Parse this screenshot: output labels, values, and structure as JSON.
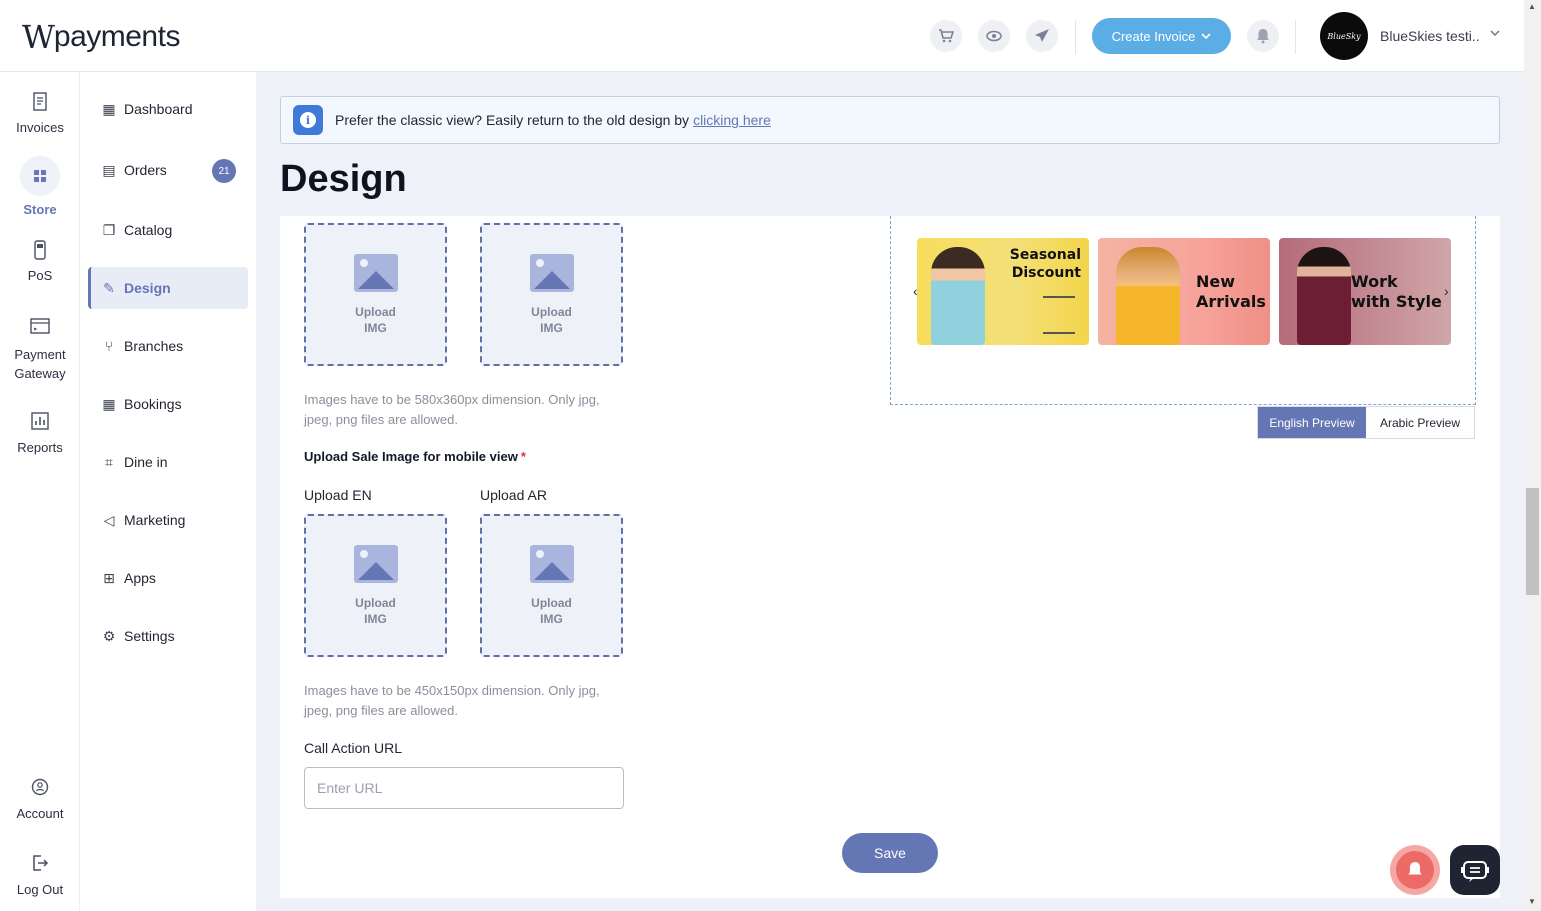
{
  "header": {
    "logo_mark": "W",
    "logo_text": "payments",
    "icons": [
      "cart-icon",
      "eye-icon",
      "send-icon",
      "bell-icon"
    ],
    "create_invoice_label": "Create Invoice",
    "profile_avatar_text": "BlueSky",
    "profile_name": "BlueSkies testi...",
    "accent_color": "#5aaee5"
  },
  "rail": {
    "items": [
      {
        "label": "Invoices",
        "icon": "invoice-icon"
      },
      {
        "label": "Store",
        "icon": "store-icon",
        "active": true
      },
      {
        "label": "PoS",
        "icon": "pos-icon"
      },
      {
        "label": "Payment Gateway",
        "icon": "payment-gateway-icon"
      },
      {
        "label": "Reports",
        "icon": "reports-icon"
      },
      {
        "label": "Account",
        "icon": "account-icon"
      },
      {
        "label": "Log Out",
        "icon": "logout-icon"
      }
    ]
  },
  "sidebar": {
    "items": [
      {
        "label": "Dashboard",
        "icon": "dashboard-icon"
      },
      {
        "label": "Orders",
        "icon": "orders-icon",
        "badge": "21"
      },
      {
        "label": "Catalog",
        "icon": "catalog-icon"
      },
      {
        "label": "Design",
        "icon": "design-icon",
        "active": true
      },
      {
        "label": "Branches",
        "icon": "branches-icon"
      },
      {
        "label": "Bookings",
        "icon": "bookings-icon"
      },
      {
        "label": "Dine in",
        "icon": "dine-in-icon"
      },
      {
        "label": "Marketing",
        "icon": "marketing-icon"
      },
      {
        "label": "Apps",
        "icon": "apps-icon"
      },
      {
        "label": "Settings",
        "icon": "settings-icon"
      }
    ]
  },
  "banner": {
    "text": "Prefer the classic view? Easily return to the old design by",
    "link": "clicking here"
  },
  "page": {
    "title": "Design"
  },
  "desktop_upload": {
    "box_label_line1": "Upload",
    "box_label_line2": "IMG",
    "hint": "Images have to be 580x360px dimension. Only jpg, jpeg, png files are allowed."
  },
  "mobile_upload": {
    "section_title": "Upload Sale Image for mobile view",
    "required_mark": "*",
    "en_label": "Upload EN",
    "ar_label": "Upload AR",
    "box_label_line1": "Upload",
    "box_label_line2": "IMG",
    "hint": "Images have to be 450x150px dimension. Only jpg, jpeg, png files are allowed."
  },
  "call_action": {
    "label": "Call Action URL",
    "placeholder": "Enter URL",
    "value": ""
  },
  "save_label": "Save",
  "preview": {
    "slides": [
      {
        "line1": "Seasonal",
        "line2": "Discount"
      },
      {
        "line1": "New",
        "line2": "Arrivals"
      },
      {
        "line1": "Work",
        "line2": "with Style"
      }
    ],
    "prev_arrow": "‹",
    "next_arrow": "›",
    "english_label": "English Preview",
    "arabic_label": "Arabic Preview",
    "active": "English Preview"
  }
}
